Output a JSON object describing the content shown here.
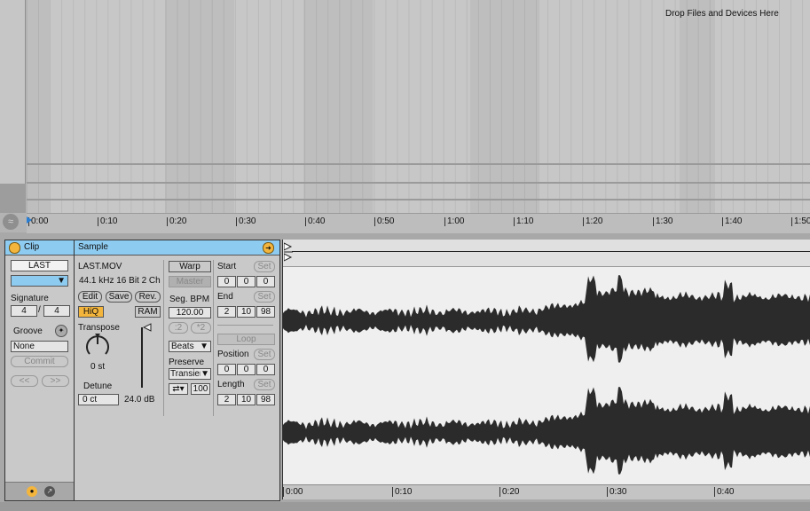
{
  "arrangement": {
    "drop_message": "Drop Files and Devices Here",
    "ruler_ticks": [
      "0:00",
      "0:10",
      "0:20",
      "0:30",
      "0:40",
      "0:50",
      "1:00",
      "1:10",
      "1:20",
      "1:30",
      "1:40",
      "1:50"
    ]
  },
  "clip": {
    "title": "Clip",
    "name": "LAST",
    "signature_label": "Signature",
    "sig_num": "4",
    "sig_sep": "/",
    "sig_den": "4",
    "groove_label": "Groove",
    "groove_value": "None",
    "commit_label": "Commit",
    "prev_label": "<<",
    "next_label": ">>"
  },
  "sample": {
    "title": "Sample",
    "file_name": "LAST.MOV",
    "file_info": "44.1 kHz 16 Bit 2 Ch",
    "edit_label": "Edit",
    "save_label": "Save",
    "rev_label": "Rev.",
    "hiq_label": "HiQ",
    "ram_label": "RAM",
    "transpose_label": "Transpose",
    "transpose_value": "0 st",
    "detune_label": "Detune",
    "detune_value": "0 ct",
    "gain_value": "24.0 dB",
    "warp_label": "Warp",
    "master_label": "Master",
    "seg_bpm_label": "Seg. BPM",
    "seg_bpm_value": "120.00",
    "half_label": ":2",
    "double_label": "*2",
    "warp_mode": "Beats",
    "preserve_label": "Preserve",
    "preserve_value": "Transien",
    "loop_mode_value": "100",
    "start_label": "Start",
    "start_values": [
      "0",
      "0",
      "0"
    ],
    "end_label": "End",
    "end_values": [
      "2",
      "10",
      "98"
    ],
    "set_label": "Set",
    "loop_label": "Loop",
    "position_label": "Position",
    "position_values": [
      "0",
      "0",
      "0"
    ],
    "length_label": "Length",
    "length_values": [
      "2",
      "10",
      "98"
    ]
  },
  "waveform": {
    "ruler_ticks": [
      "0:00",
      "0:10",
      "0:20",
      "0:30",
      "0:40"
    ]
  }
}
